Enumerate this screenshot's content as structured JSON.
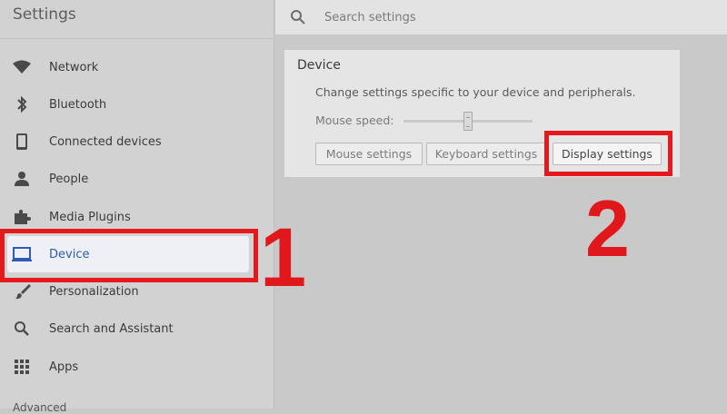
{
  "app": {
    "title": "Settings"
  },
  "search": {
    "placeholder": "Search settings"
  },
  "sidebar": {
    "items": [
      {
        "label": "Network",
        "icon": "wifi-icon"
      },
      {
        "label": "Bluetooth",
        "icon": "bluetooth-icon"
      },
      {
        "label": "Connected devices",
        "icon": "phone-icon"
      },
      {
        "label": "People",
        "icon": "person-icon"
      },
      {
        "label": "Media Plugins",
        "icon": "puzzle-icon"
      },
      {
        "label": "Device",
        "icon": "laptop-icon",
        "active": true
      },
      {
        "label": "Personalization",
        "icon": "brush-icon"
      },
      {
        "label": "Search and Assistant",
        "icon": "search-icon"
      },
      {
        "label": "Apps",
        "icon": "apps-grid-icon"
      }
    ],
    "advanced_label": "Advanced"
  },
  "device_card": {
    "title": "Device",
    "description": "Change settings specific to your device and peripherals.",
    "mouse_speed_label": "Mouse speed:",
    "mouse_speed_level": 0.5,
    "buttons": {
      "mouse": "Mouse settings",
      "keyboard": "Keyboard settings",
      "display": "Display settings"
    }
  },
  "annotations": {
    "step1": "1",
    "step2": "2"
  },
  "colors": {
    "accent_active": "#2f5bb5",
    "annotation_red": "#e5191c",
    "sidebar_bg": "#d2d2d2",
    "content_bg": "#c9c9c9"
  }
}
